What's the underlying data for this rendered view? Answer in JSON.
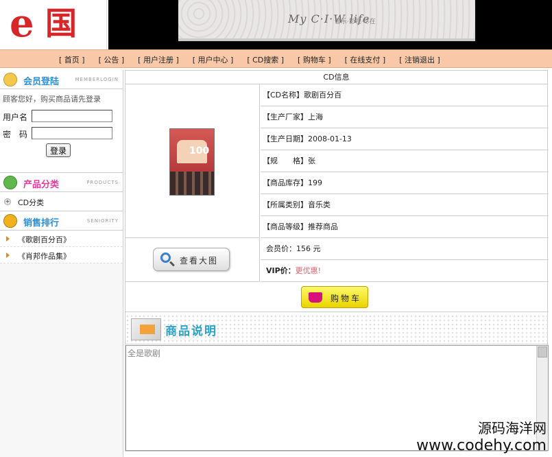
{
  "logo": {
    "letter": "e",
    "char": "国"
  },
  "banner": {
    "title": "My C·I·W life",
    "subtitle": "音乐·影视·尽在"
  },
  "nav": {
    "items": [
      "[ 首页 ]",
      "[ 公告 ]",
      "[ 用户注册 ]",
      "[ 用户中心 ]",
      "[ CD搜索 ]",
      "[ 购物车 ]",
      "[ 在线支付 ]",
      "[ 注销退出 ]"
    ]
  },
  "login": {
    "title": "会员登陆",
    "subtitle": "MEMBERLOGIN",
    "greeting": "顾客您好，购买商品请先登录",
    "username_label": "用户名",
    "password_label": "密　码",
    "username_value": "",
    "password_value": "",
    "button_label": "登录"
  },
  "category": {
    "title": "产品分类",
    "subtitle": "PRODUCTS",
    "items": [
      "CD分类"
    ]
  },
  "ranking": {
    "title": "销售排行",
    "subtitle": "SENIORITY",
    "items": [
      "《歌剧百分百》",
      "《肖邦作品集》"
    ]
  },
  "product": {
    "section_title": "CD信息",
    "cover_number": "100",
    "attrs": [
      "【CD名称】歌剧百分百",
      "【生产厂家】上海",
      "【生产日期】2008-01-13",
      "【规　　格】张",
      "【商品库存】199",
      "【所属类别】音乐类",
      "【商品等级】推荐商品"
    ],
    "member_price": "会员价：156 元",
    "vip_label": "VIP价：",
    "vip_value": "更优惠!",
    "zoom_label": "查看大图",
    "cart_label": "购物车"
  },
  "description": {
    "title": "商品说明",
    "text": "全是歌剧"
  },
  "watermark": {
    "line1": "源码海洋网",
    "line2": "www.codehy.com"
  },
  "colors": {
    "nav_bg": "#f8c8a8",
    "logo_red": "#d6262a",
    "vip_red": "#e0626a",
    "accent_blue": "#2aa3c9"
  }
}
